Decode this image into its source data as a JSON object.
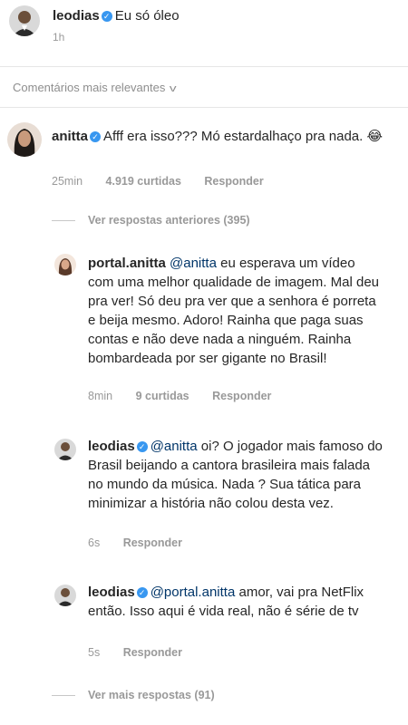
{
  "post": {
    "username": "leodias",
    "caption": "Eu só óleo",
    "time": "1h"
  },
  "comments_header": {
    "label": "Comentários mais relevantes"
  },
  "top_comment": {
    "username": "anitta",
    "text": "Afff era isso??? Mó estardalhaço pra nada. 😂",
    "time": "25min",
    "likes": "4.919 curtidas",
    "reply_label": "Responder"
  },
  "view_previous": "Ver respostas anteriores (395)",
  "replies": [
    {
      "username": "portal.anitta",
      "mention": "@anitta",
      "text": "eu esperava um vídeo com uma melhor qualidade de imagem. Mal deu pra ver! Só deu pra ver que a senhora é porreta e beija mesmo. Adoro! Rainha que paga suas contas e não deve nada a ninguém. Rainha bombardeada por ser gigante no Brasil!",
      "time": "8min",
      "likes": "9 curtidas",
      "reply_label": "Responder"
    },
    {
      "username": "leodias",
      "mention": "@anitta",
      "text": "oi? O jogador mais famoso do Brasil beijando a cantora brasileira mais falada no mundo da música. Nada ? Sua tática para minimizar a história não colou desta vez.",
      "time": "6s",
      "reply_label": "Responder"
    },
    {
      "username": "leodias",
      "mention": "@portal.anitta",
      "text": "amor, vai pra NetFlix então. Isso aqui é vida real, não é série de tv",
      "time": "5s",
      "reply_label": "Responder"
    }
  ],
  "view_more": "Ver mais respostas (91)",
  "colors": {
    "verified": "#3897f0",
    "mention": "#003569",
    "muted": "#999999"
  }
}
